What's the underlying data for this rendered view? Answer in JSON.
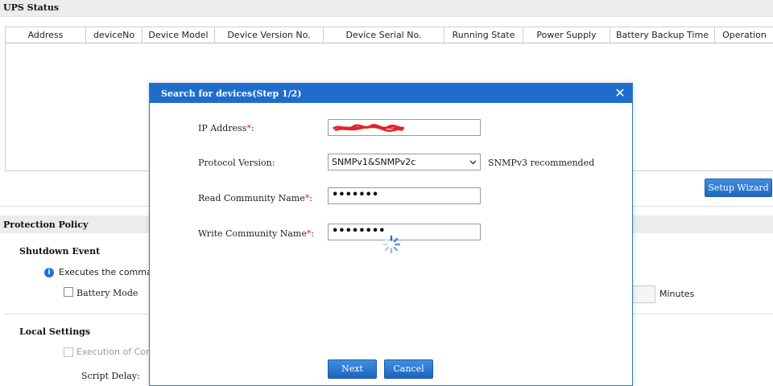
{
  "ups_status": {
    "title": "UPS Status",
    "columns": [
      "Address",
      "deviceNo",
      "Device Model",
      "Device Version No.",
      "Device Serial No.",
      "Running State",
      "Power Supply",
      "Battery Backup Time",
      "Operation"
    ]
  },
  "setup_wizard_label": "Setup Wizard",
  "protection_policy": {
    "title": "Protection Policy",
    "shutdown_event": {
      "title": "Shutdown Event",
      "info_text": "Executes the command",
      "battery_mode_label": "Battery Mode",
      "minutes_label": "Minutes"
    },
    "local_settings": {
      "title": "Local Settings",
      "execution_label": "Execution of Comm",
      "script_delay_label": "Script Delay:"
    }
  },
  "dialog": {
    "title": "Search for devices(Step 1/2)",
    "close_glyph": "✕",
    "ip_label": "IP Address",
    "protocol_label": "Protocol Version:",
    "protocol_value": "SNMPv1&SNMPv2c",
    "protocol_hint": "SNMPv3 recommended",
    "read_label": "Read Community Name",
    "read_value": "•••••••",
    "write_label": "Write Community Name",
    "write_value": "••••••••",
    "required_mark": "*",
    "colon": ":",
    "next_label": "Next",
    "cancel_label": "Cancel"
  },
  "colors": {
    "dialog_header": "#1e6dcd",
    "button_blue": "#2a74d0",
    "required": "#e02020",
    "redaction": "#e8202a"
  }
}
